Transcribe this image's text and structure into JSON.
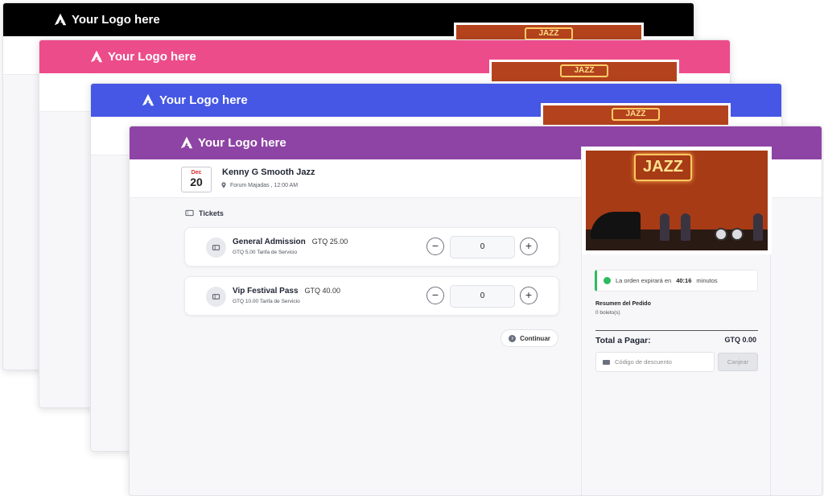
{
  "logo_text": "Your Logo here",
  "colors": {
    "window_1_header": "#000000",
    "window_2_header": "#ec4c8a",
    "window_3_header": "#4557e4",
    "window_4_header": "#8e44a4",
    "timer_accent": "#2dbb5d",
    "date_month": "#d62f2f"
  },
  "photo_sign": "JAZZ",
  "event": {
    "month": "Dec",
    "day": "20",
    "title": "Kenny G Smooth Jazz",
    "location": "Forum Majadas , 12:00 AM"
  },
  "tickets_heading": "Tickets",
  "tickets": [
    {
      "name": "General Admission",
      "price": "GTQ 25.00",
      "fee": "GTQ 5.00 Tarifa de Servicio",
      "quantity": "0"
    },
    {
      "name": "Vip Festival Pass",
      "price": "GTQ 40.00",
      "fee": "GTQ 10.00 Tarifa de Servicio",
      "quantity": "0"
    }
  ],
  "stepper": {
    "minus": "−",
    "plus": "+"
  },
  "continue_label": "Continuar",
  "sidebar": {
    "timer_prefix": "La orden expirará en",
    "timer_value": "40:16",
    "timer_suffix": "minutos",
    "summary_title": "Resumen del Pedido",
    "summary_count": "0 boleto(s)",
    "total_label": "Total a Pagar:",
    "total_value": "GTQ 0.00",
    "discount_placeholder": "Código de descuento",
    "redeem_label": "Canjear"
  },
  "icons": [
    "logo-icon",
    "location-pin-icon",
    "ticket-icon",
    "clock-icon",
    "tag-icon",
    "arrow-right-icon"
  ]
}
